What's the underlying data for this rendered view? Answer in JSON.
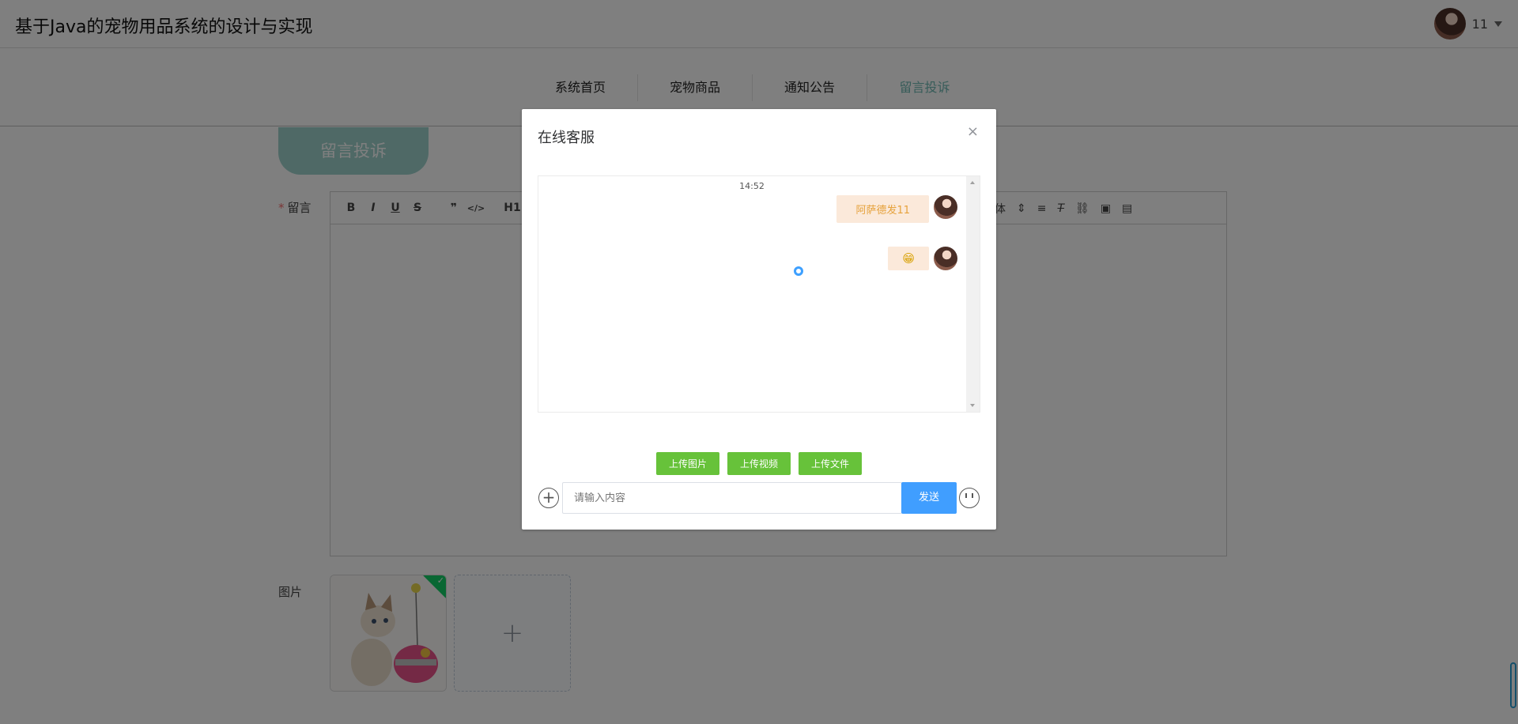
{
  "header": {
    "title": "基于Java的宠物用品系统的设计与实现",
    "username": "11"
  },
  "nav": {
    "items": [
      "系统首页",
      "宠物商品",
      "通知公告",
      "留言投诉"
    ],
    "active": 3
  },
  "form": {
    "section_tab": "留言投诉",
    "message_label": "留言",
    "required_mark": "*",
    "image_label": "图片",
    "toolbar": {
      "bold": "B",
      "italic": "I",
      "underline": "U",
      "strike": "S",
      "quote": "❞",
      "code": "</>",
      "h1": "H1",
      "font": "体",
      "align": "≡",
      "clear": "T"
    }
  },
  "dialog": {
    "title": "在线客服",
    "close": "×",
    "chat_time": "14:52",
    "messages": [
      {
        "text": "阿萨德发11"
      },
      {
        "text": "😁"
      }
    ],
    "upload_buttons": [
      "上传图片",
      "上传视频",
      "上传文件"
    ],
    "input_placeholder": "请输入内容",
    "send_label": "发送"
  },
  "colors": {
    "accent": "#409eff",
    "green": "#67c23a",
    "teal": "#9ed3cd",
    "bubble": "#fbe9da"
  }
}
